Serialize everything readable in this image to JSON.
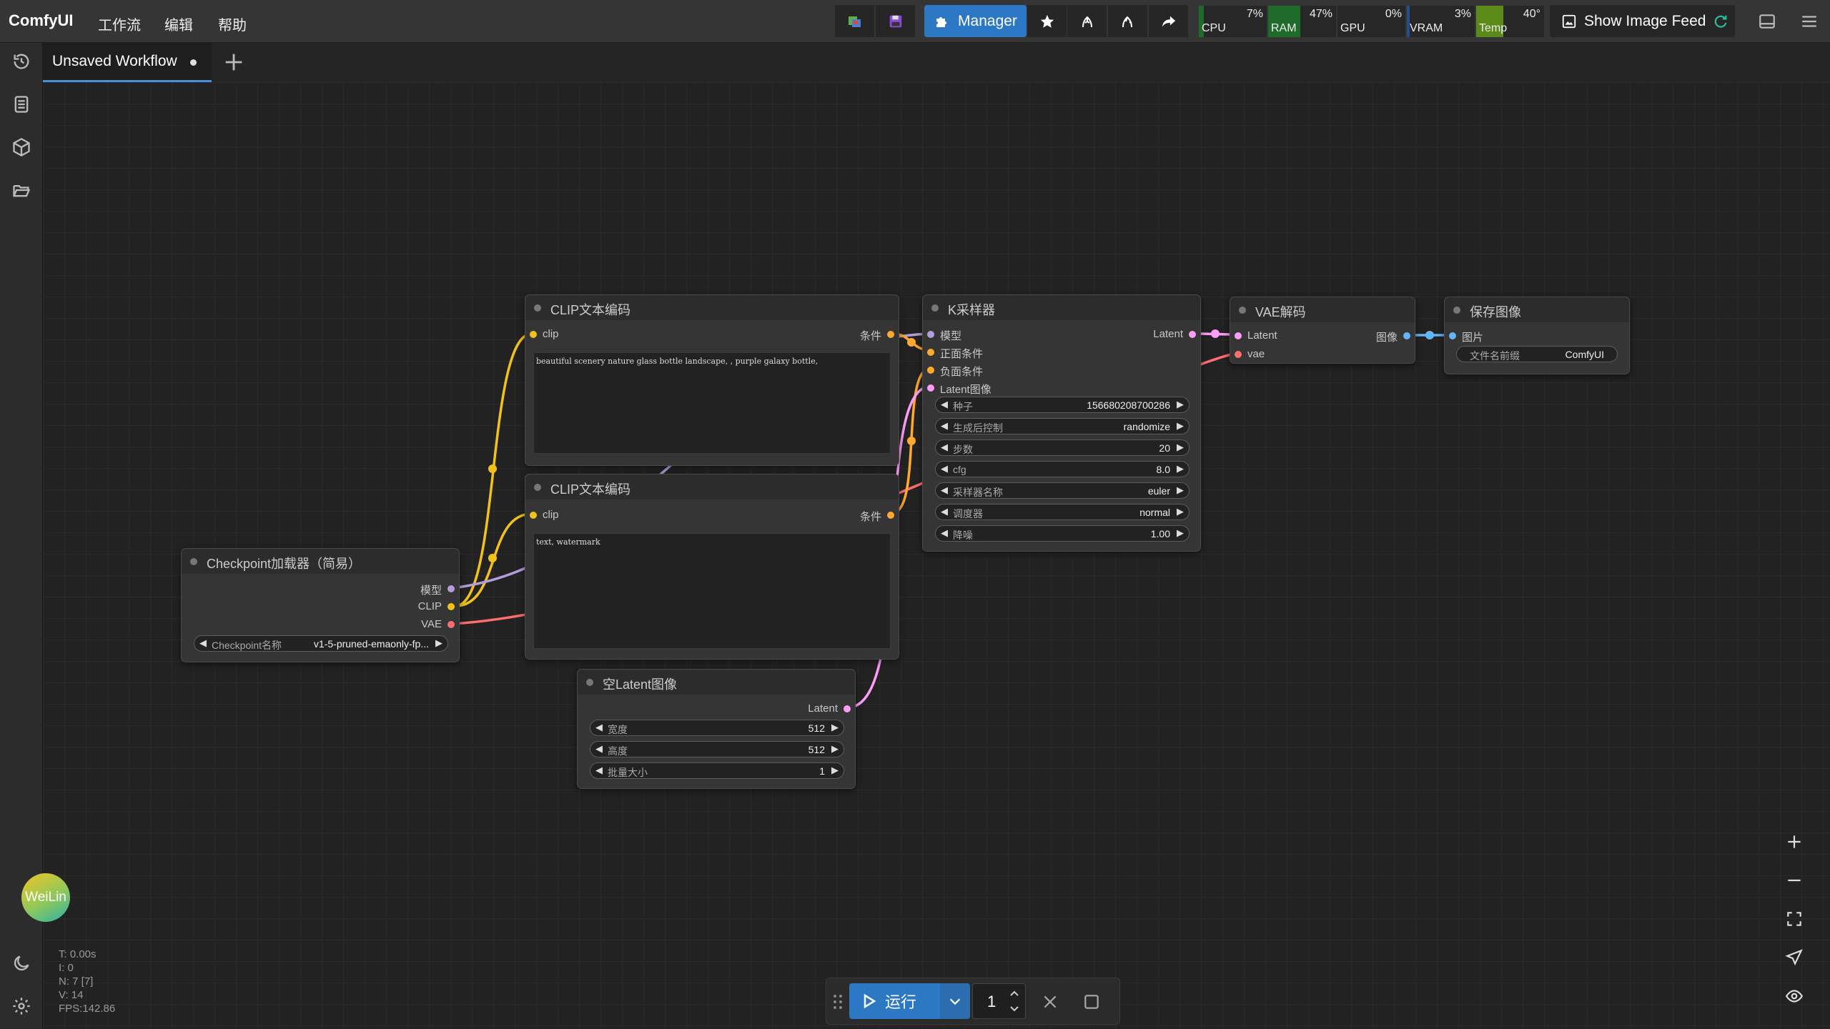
{
  "app": {
    "brand": "ComfyUI"
  },
  "menu": {
    "workflow": "工作流",
    "edit": "编辑",
    "help": "帮助"
  },
  "toolbar": {
    "manager_label": "Manager",
    "feed_label": "Show Image Feed",
    "monitors": [
      {
        "label": "CPU",
        "value": "7%",
        "fill": 0.07,
        "color": "#1f6b2b"
      },
      {
        "label": "RAM",
        "value": "47%",
        "fill": 0.47,
        "color": "#1f6b2b"
      },
      {
        "label": "GPU",
        "value": "0%",
        "fill": 0.0,
        "color": "#1f6b2b"
      },
      {
        "label": "VRAM",
        "value": "3%",
        "fill": 0.03,
        "color": "#1f4f8f"
      },
      {
        "label": "Temp",
        "value": "40°",
        "fill": 0.4,
        "color": "#5b8a1a"
      }
    ]
  },
  "tabs": {
    "active": "Unsaved Workflow"
  },
  "colors": {
    "accent": "#2d78c4",
    "clip": "#f2c21b",
    "model": "#b39ddb",
    "vae": "#ff6e6e",
    "latent": "#ff9cf9",
    "image": "#64b5f6",
    "conditioning": "#ffa931"
  },
  "nodes": {
    "checkpoint": {
      "title": "Checkpoint加载器（简易）",
      "outputs": [
        "模型",
        "CLIP",
        "VAE"
      ],
      "widget_label": "Checkpoint名称",
      "widget_value": "v1-5-pruned-emaonly-fp..."
    },
    "clip_pos": {
      "title": "CLIP文本编码",
      "input": "clip",
      "output": "条件",
      "text": "beautiful scenery nature glass bottle landscape, , purple galaxy bottle,"
    },
    "clip_neg": {
      "title": "CLIP文本编码",
      "input": "clip",
      "output": "条件",
      "text": "text, watermark"
    },
    "ksampler": {
      "title": "K采样器",
      "inputs": [
        "模型",
        "正面条件",
        "负面条件",
        "Latent图像"
      ],
      "output": "Latent",
      "widgets": [
        {
          "label": "种子",
          "value": "156680208700286"
        },
        {
          "label": "生成后控制",
          "value": "randomize"
        },
        {
          "label": "步数",
          "value": "20"
        },
        {
          "label": "cfg",
          "value": "8.0"
        },
        {
          "label": "采样器名称",
          "value": "euler"
        },
        {
          "label": "调度器",
          "value": "normal"
        },
        {
          "label": "降噪",
          "value": "1.00"
        }
      ]
    },
    "vae_decode": {
      "title": "VAE解码",
      "inputs": [
        "Latent",
        "vae"
      ],
      "output": "图像"
    },
    "save_image": {
      "title": "保存图像",
      "input": "图片",
      "widget_label": "文件名前缀",
      "widget_value": "ComfyUI"
    },
    "empty_latent": {
      "title": "空Latent图像",
      "output": "Latent",
      "widgets": [
        {
          "label": "宽度",
          "value": "512"
        },
        {
          "label": "高度",
          "value": "512"
        },
        {
          "label": "批量大小",
          "value": "1"
        }
      ]
    }
  },
  "avatar": {
    "text": "WeiLin"
  },
  "stats": {
    "t": "T: 0.00s",
    "i": "I: 0",
    "n": "N: 7 [7]",
    "v": "V: 14",
    "fps": "FPS:142.86"
  },
  "runbar": {
    "run_label": "运行",
    "batch_count": "1"
  }
}
